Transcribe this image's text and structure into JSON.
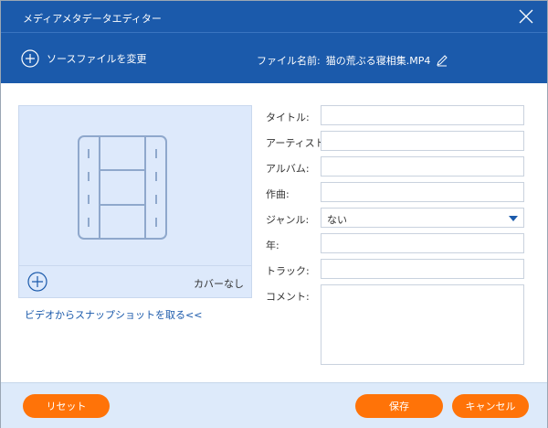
{
  "window": {
    "title": "メディアメタデータエディター"
  },
  "header": {
    "change_source": "ソースファイルを変更",
    "file_label": "ファイル名前:",
    "file_name": "猫の荒ぶる寝相集.MP4"
  },
  "cover": {
    "no_cover": "カバーなし",
    "snapshot_link": "ビデオからスナップショットを取る<<"
  },
  "form": {
    "title": {
      "label": "タイトル:",
      "value": ""
    },
    "artist": {
      "label": "アーティスト:",
      "value": ""
    },
    "album": {
      "label": "アルバム:",
      "value": ""
    },
    "composer": {
      "label": "作曲:",
      "value": ""
    },
    "genre": {
      "label": "ジャンル:",
      "value": "ない"
    },
    "year": {
      "label": "年:",
      "value": ""
    },
    "track": {
      "label": "トラック:",
      "value": ""
    },
    "comment": {
      "label": "コメント:",
      "value": ""
    }
  },
  "footer": {
    "reset": "リセット",
    "save": "保存",
    "cancel": "キャンセル"
  },
  "colors": {
    "primary": "#1b5aab",
    "accent": "#ff7308",
    "panel": "#dde9fb"
  }
}
